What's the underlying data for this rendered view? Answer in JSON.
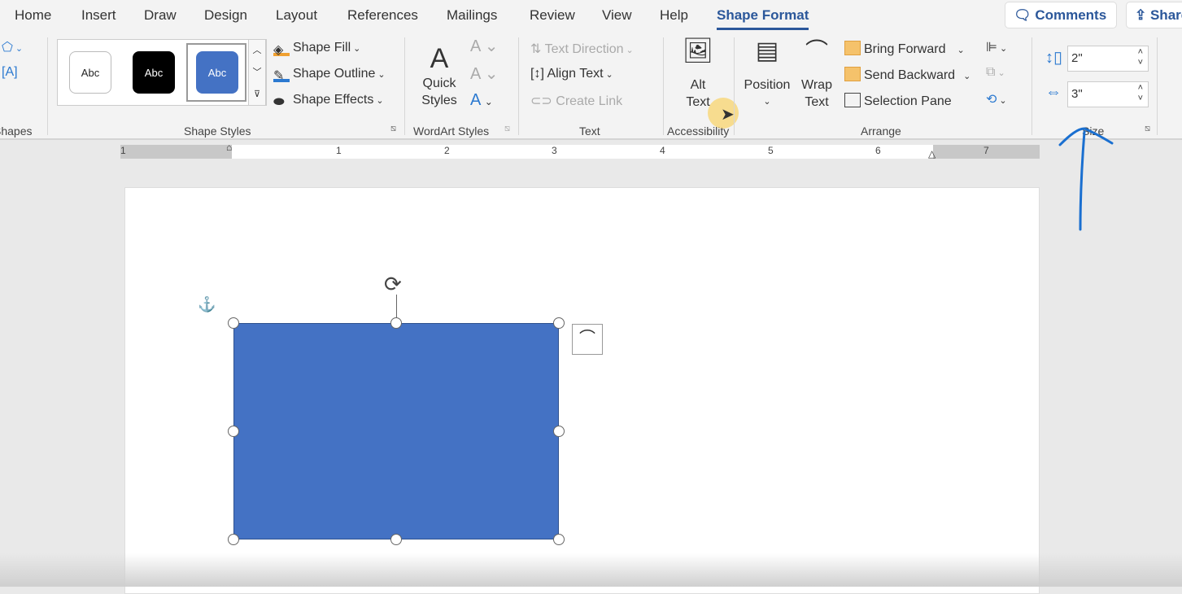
{
  "tabs": [
    "Home",
    "Insert",
    "Draw",
    "Design",
    "Layout",
    "References",
    "Mailings",
    "Review",
    "View",
    "Help",
    "Shape Format"
  ],
  "active_tab": "Shape Format",
  "header_buttons": {
    "comments": "Comments",
    "share": "Share"
  },
  "ribbon": {
    "insert_shapes": {
      "label": "Shapes"
    },
    "shape_styles": {
      "label": "Shape Styles",
      "swatch_text": "Abc",
      "fill": "Shape Fill",
      "outline": "Shape Outline",
      "effects": "Shape Effects"
    },
    "wordart": {
      "label": "WordArt Styles",
      "quick_styles": "Quick Styles"
    },
    "text": {
      "label": "Text",
      "direction": "Text Direction",
      "align": "Align Text",
      "link": "Create Link"
    },
    "accessibility": {
      "label": "Accessibility",
      "alt_text": "Alt Text"
    },
    "arrange": {
      "label": "Arrange",
      "position": "Position",
      "wrap": "Wrap Text",
      "bring_forward": "Bring Forward",
      "send_backward": "Send Backward",
      "selection_pane": "Selection Pane"
    },
    "size": {
      "label": "Size",
      "height": "2\"",
      "width": "3\""
    }
  },
  "ruler": [
    "1",
    "1",
    "2",
    "3",
    "4",
    "5",
    "6",
    "7"
  ],
  "colors": {
    "accent": "#2b579a",
    "shape": "#4472c4",
    "annotation": "#1a6fd0"
  }
}
